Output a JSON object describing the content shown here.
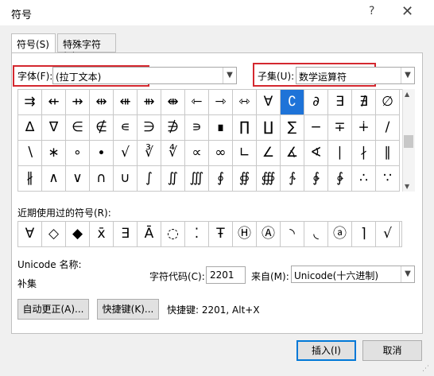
{
  "window": {
    "title": "符号",
    "help_glyph": "?",
    "close_glyph": "✕"
  },
  "tabs": [
    {
      "label": "符号(S)",
      "active": true
    },
    {
      "label": "特殊字符(P)",
      "active": false
    }
  ],
  "font": {
    "label": "字体(F):",
    "value": "(拉丁文本)"
  },
  "subset": {
    "label": "子集(U):",
    "value": "数学运算符"
  },
  "symbols": [
    [
      "⇉",
      "⇷",
      "⇸",
      "⇹",
      "⇺",
      "⇻",
      "⇼",
      "⇽",
      "⇾",
      "⇿",
      "∀",
      "∁",
      "∂",
      "∃",
      "∄",
      "∅"
    ],
    [
      "∆",
      "∇",
      "∈",
      "∉",
      "∊",
      "∋",
      "∌",
      "∍",
      "∎",
      "∏",
      "∐",
      "∑",
      "−",
      "∓",
      "∔",
      "∕"
    ],
    [
      "∖",
      "∗",
      "∘",
      "∙",
      "√",
      "∛",
      "∜",
      "∝",
      "∞",
      "∟",
      "∠",
      "∡",
      "∢",
      "∣",
      "∤",
      "∥"
    ],
    [
      "∦",
      "∧",
      "∨",
      "∩",
      "∪",
      "∫",
      "∬",
      "∭",
      "∮",
      "∯",
      "∰",
      "∱",
      "∲",
      "∳",
      "∴",
      "∵"
    ]
  ],
  "selected_symbol": "∁",
  "recent_label": "近期使用过的符号(R):",
  "recent_symbols": [
    "∀",
    "◇",
    "◆",
    "x̄",
    "∃",
    "Ā",
    "◌",
    "⁚",
    "Ŧ",
    "Ⓗ",
    "Ⓐ",
    "◝",
    "◟",
    "ⓐ",
    "⌉",
    "√"
  ],
  "unicode_name_label": "Unicode 名称:",
  "unicode_name_value": "补集",
  "char_code": {
    "label": "字符代码(C):",
    "value": "2201"
  },
  "from": {
    "label": "来自(M):",
    "value": "Unicode(十六进制)"
  },
  "buttons": {
    "autocorrect": "自动更正(A)...",
    "shortcut_key": "快捷键(K)...",
    "insert": "插入(I)",
    "cancel": "取消"
  },
  "shortcut_text": "快捷键: 2201, Alt+X",
  "colors": {
    "highlight": "#d4282f",
    "selection": "#1e73d8",
    "focus": "#0078d7"
  }
}
